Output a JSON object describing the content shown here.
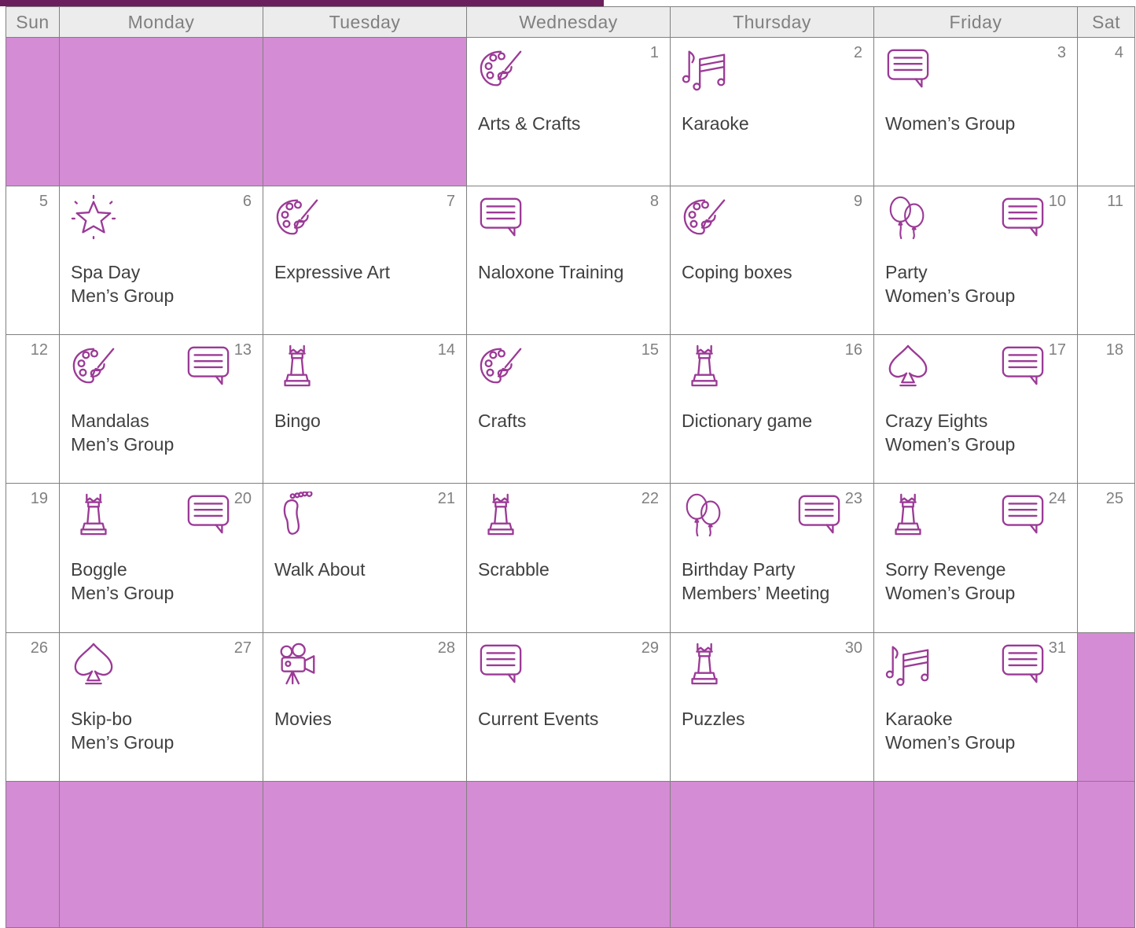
{
  "weekdays": [
    "Sun",
    "Monday",
    "Tuesday",
    "Wednesday",
    "Thursday",
    "Friday",
    "Sat"
  ],
  "accent_color": "#d48cd4",
  "icon_color": "#9b3a96",
  "weeks": [
    [
      {
        "empty": true
      },
      {
        "empty": true
      },
      {
        "empty": true
      },
      {
        "day": "1",
        "icons": [
          "palette-icon"
        ],
        "events": [
          "Arts & Crafts"
        ]
      },
      {
        "day": "2",
        "icons": [
          "music-notes-icon"
        ],
        "events": [
          "Karaoke"
        ]
      },
      {
        "day": "3",
        "icons": [
          "speech-bubble-icon"
        ],
        "events": [
          "Women’s Group"
        ]
      },
      {
        "day": "4",
        "icons": [],
        "events": []
      }
    ],
    [
      {
        "day": "5",
        "icons": [],
        "events": []
      },
      {
        "day": "6",
        "icons": [
          "sparkle-star-icon"
        ],
        "events": [
          "Spa Day",
          "Men’s Group"
        ]
      },
      {
        "day": "7",
        "icons": [
          "palette-icon"
        ],
        "events": [
          "Expressive Art"
        ]
      },
      {
        "day": "8",
        "icons": [
          "speech-bubble-icon"
        ],
        "events": [
          "Naloxone Training"
        ]
      },
      {
        "day": "9",
        "icons": [
          "palette-icon"
        ],
        "events": [
          "Coping boxes"
        ]
      },
      {
        "day": "10",
        "icons": [
          "balloons-icon",
          "speech-bubble-icon"
        ],
        "events": [
          "Party",
          "Women’s Group"
        ]
      },
      {
        "day": "11",
        "icons": [],
        "events": []
      }
    ],
    [
      {
        "day": "12",
        "icons": [],
        "events": []
      },
      {
        "day": "13",
        "icons": [
          "palette-icon",
          "speech-bubble-icon"
        ],
        "events": [
          "Mandalas",
          "Men’s Group"
        ]
      },
      {
        "day": "14",
        "icons": [
          "chess-queen-icon"
        ],
        "events": [
          "Bingo"
        ]
      },
      {
        "day": "15",
        "icons": [
          "palette-icon"
        ],
        "events": [
          "Crafts"
        ]
      },
      {
        "day": "16",
        "icons": [
          "chess-queen-icon"
        ],
        "events": [
          "Dictionary game"
        ]
      },
      {
        "day": "17",
        "icons": [
          "spade-icon",
          "speech-bubble-icon"
        ],
        "events": [
          "Crazy Eights",
          "Women’s Group"
        ]
      },
      {
        "day": "18",
        "icons": [],
        "events": []
      }
    ],
    [
      {
        "day": "19",
        "icons": [],
        "events": []
      },
      {
        "day": "20",
        "icons": [
          "chess-queen-icon",
          "speech-bubble-icon"
        ],
        "events": [
          "Boggle",
          "Men’s Group"
        ]
      },
      {
        "day": "21",
        "icons": [
          "footprint-icon"
        ],
        "events": [
          "Walk About"
        ]
      },
      {
        "day": "22",
        "icons": [
          "chess-queen-icon"
        ],
        "events": [
          "Scrabble"
        ]
      },
      {
        "day": "23",
        "icons": [
          "balloons-icon",
          "speech-bubble-icon"
        ],
        "events": [
          "Birthday Party",
          "Members’ Meeting"
        ]
      },
      {
        "day": "24",
        "icons": [
          "chess-queen-icon",
          "speech-bubble-icon"
        ],
        "events": [
          "Sorry Revenge",
          "Women’s Group"
        ]
      },
      {
        "day": "25",
        "icons": [],
        "events": []
      }
    ],
    [
      {
        "day": "26",
        "icons": [],
        "events": []
      },
      {
        "day": "27",
        "icons": [
          "spade-icon"
        ],
        "events": [
          "Skip-bo",
          "Men’s Group"
        ]
      },
      {
        "day": "28",
        "icons": [
          "movie-camera-icon"
        ],
        "events": [
          "Movies"
        ]
      },
      {
        "day": "29",
        "icons": [
          "speech-bubble-icon"
        ],
        "events": [
          "Current Events"
        ]
      },
      {
        "day": "30",
        "icons": [
          "chess-queen-icon"
        ],
        "events": [
          "Puzzles"
        ]
      },
      {
        "day": "31",
        "icons": [
          "music-notes-icon",
          "speech-bubble-icon"
        ],
        "events": [
          "Karaoke",
          "Women’s Group"
        ]
      },
      {
        "empty": true
      }
    ],
    [
      {
        "empty": true
      },
      {
        "empty": true
      },
      {
        "empty": true
      },
      {
        "empty": true
      },
      {
        "empty": true
      },
      {
        "empty": true
      },
      {
        "empty": true
      }
    ]
  ]
}
